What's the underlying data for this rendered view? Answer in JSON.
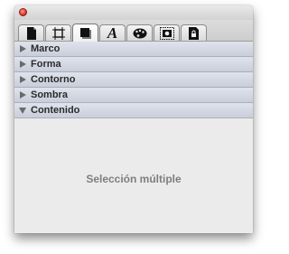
{
  "window": {
    "close_button": "close"
  },
  "tabs": [
    {
      "icon": "document-icon",
      "active": false
    },
    {
      "icon": "frame-icon",
      "active": false
    },
    {
      "icon": "shadow-square-icon",
      "active": true
    },
    {
      "icon": "text-format-icon",
      "glyph": "A",
      "active": false
    },
    {
      "icon": "color-palette-icon",
      "active": false
    },
    {
      "icon": "image-frame-icon",
      "active": false
    },
    {
      "icon": "locked-document-icon",
      "active": false
    }
  ],
  "sections": [
    {
      "label": "Marco",
      "expanded": false
    },
    {
      "label": "Forma",
      "expanded": false
    },
    {
      "label": "Contorno",
      "expanded": false
    },
    {
      "label": "Sombra",
      "expanded": false
    },
    {
      "label": "Contenido",
      "expanded": true
    }
  ],
  "content": {
    "status_text": "Selección múltiple"
  },
  "colors": {
    "close_button": "#e0443a",
    "section_header": "#d3d8e2",
    "status_text": "#7e7e7e"
  }
}
